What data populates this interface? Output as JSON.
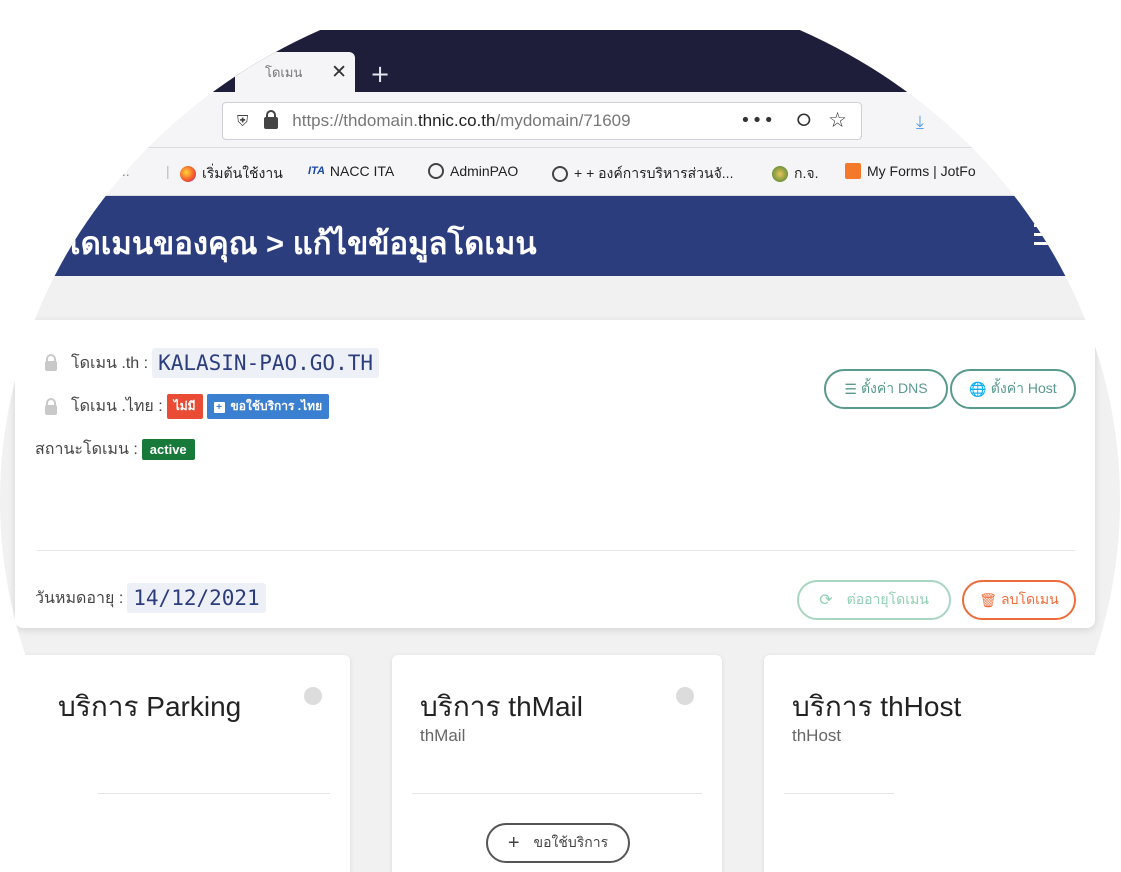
{
  "browser": {
    "tab_title": "โดเมน",
    "new_tab_label": "+",
    "close_tab_label": "✕",
    "url_prefix": "https://thdomain.",
    "url_host": "thnic.co.th",
    "url_path": "/mydomain/71609",
    "menu_dots": "•••",
    "bookmarks": [
      {
        "label": "เริ่มต้นใช้งาน",
        "icon": "firefox-icon"
      },
      {
        "label": "NACC ITA",
        "icon": "ita-icon",
        "icon_text": "ITA"
      },
      {
        "label": "AdminPAO",
        "icon": "globe-icon"
      },
      {
        "label": "+ + องค์การบริหารส่วนจั...",
        "icon": "globe-icon"
      },
      {
        "label": "ก.จ.",
        "icon": "gov-seal-icon"
      },
      {
        "label": "My Forms | JotFo",
        "icon": "jotform-icon"
      }
    ],
    "bookmark_overflow": "..."
  },
  "header": {
    "title": "โดเมนของคุณ > แก้ไขข้อมูลโดเมน"
  },
  "domain": {
    "th_label": "โดเมน .th :",
    "th_value": "KALASIN-PAO.GO.TH",
    "thai_label": "โดเมน .ไทย :",
    "thai_badge": "ไม่มี",
    "thai_request_button": "ขอใช้บริการ .ไทย",
    "status_label": "สถานะโดเมน :",
    "status_value": "active",
    "dns_button": "ตั้งค่า DNS",
    "host_button": "ตั้งค่า Host",
    "expiry_label": "วันหมดอายุ :",
    "expiry_value": "14/12/2021",
    "renew_button": "ต่ออายุโดเมน",
    "delete_button": "ลบโดเมน"
  },
  "services": [
    {
      "title": "บริการ Parking",
      "subtitle": ""
    },
    {
      "title": "บริการ thMail",
      "subtitle": "thMail",
      "request_button": "ขอใช้บริการ"
    },
    {
      "title": "บริการ thHost",
      "subtitle": "thHost"
    }
  ],
  "colors": {
    "header_bg": "#2c3d7e",
    "tabbar_bg": "#1e1e3a",
    "badge_red": "#e94b35",
    "badge_blue": "#3a7fd0",
    "badge_green": "#187a3a",
    "teal": "#5a9a8e",
    "danger": "#ef6c3a"
  }
}
